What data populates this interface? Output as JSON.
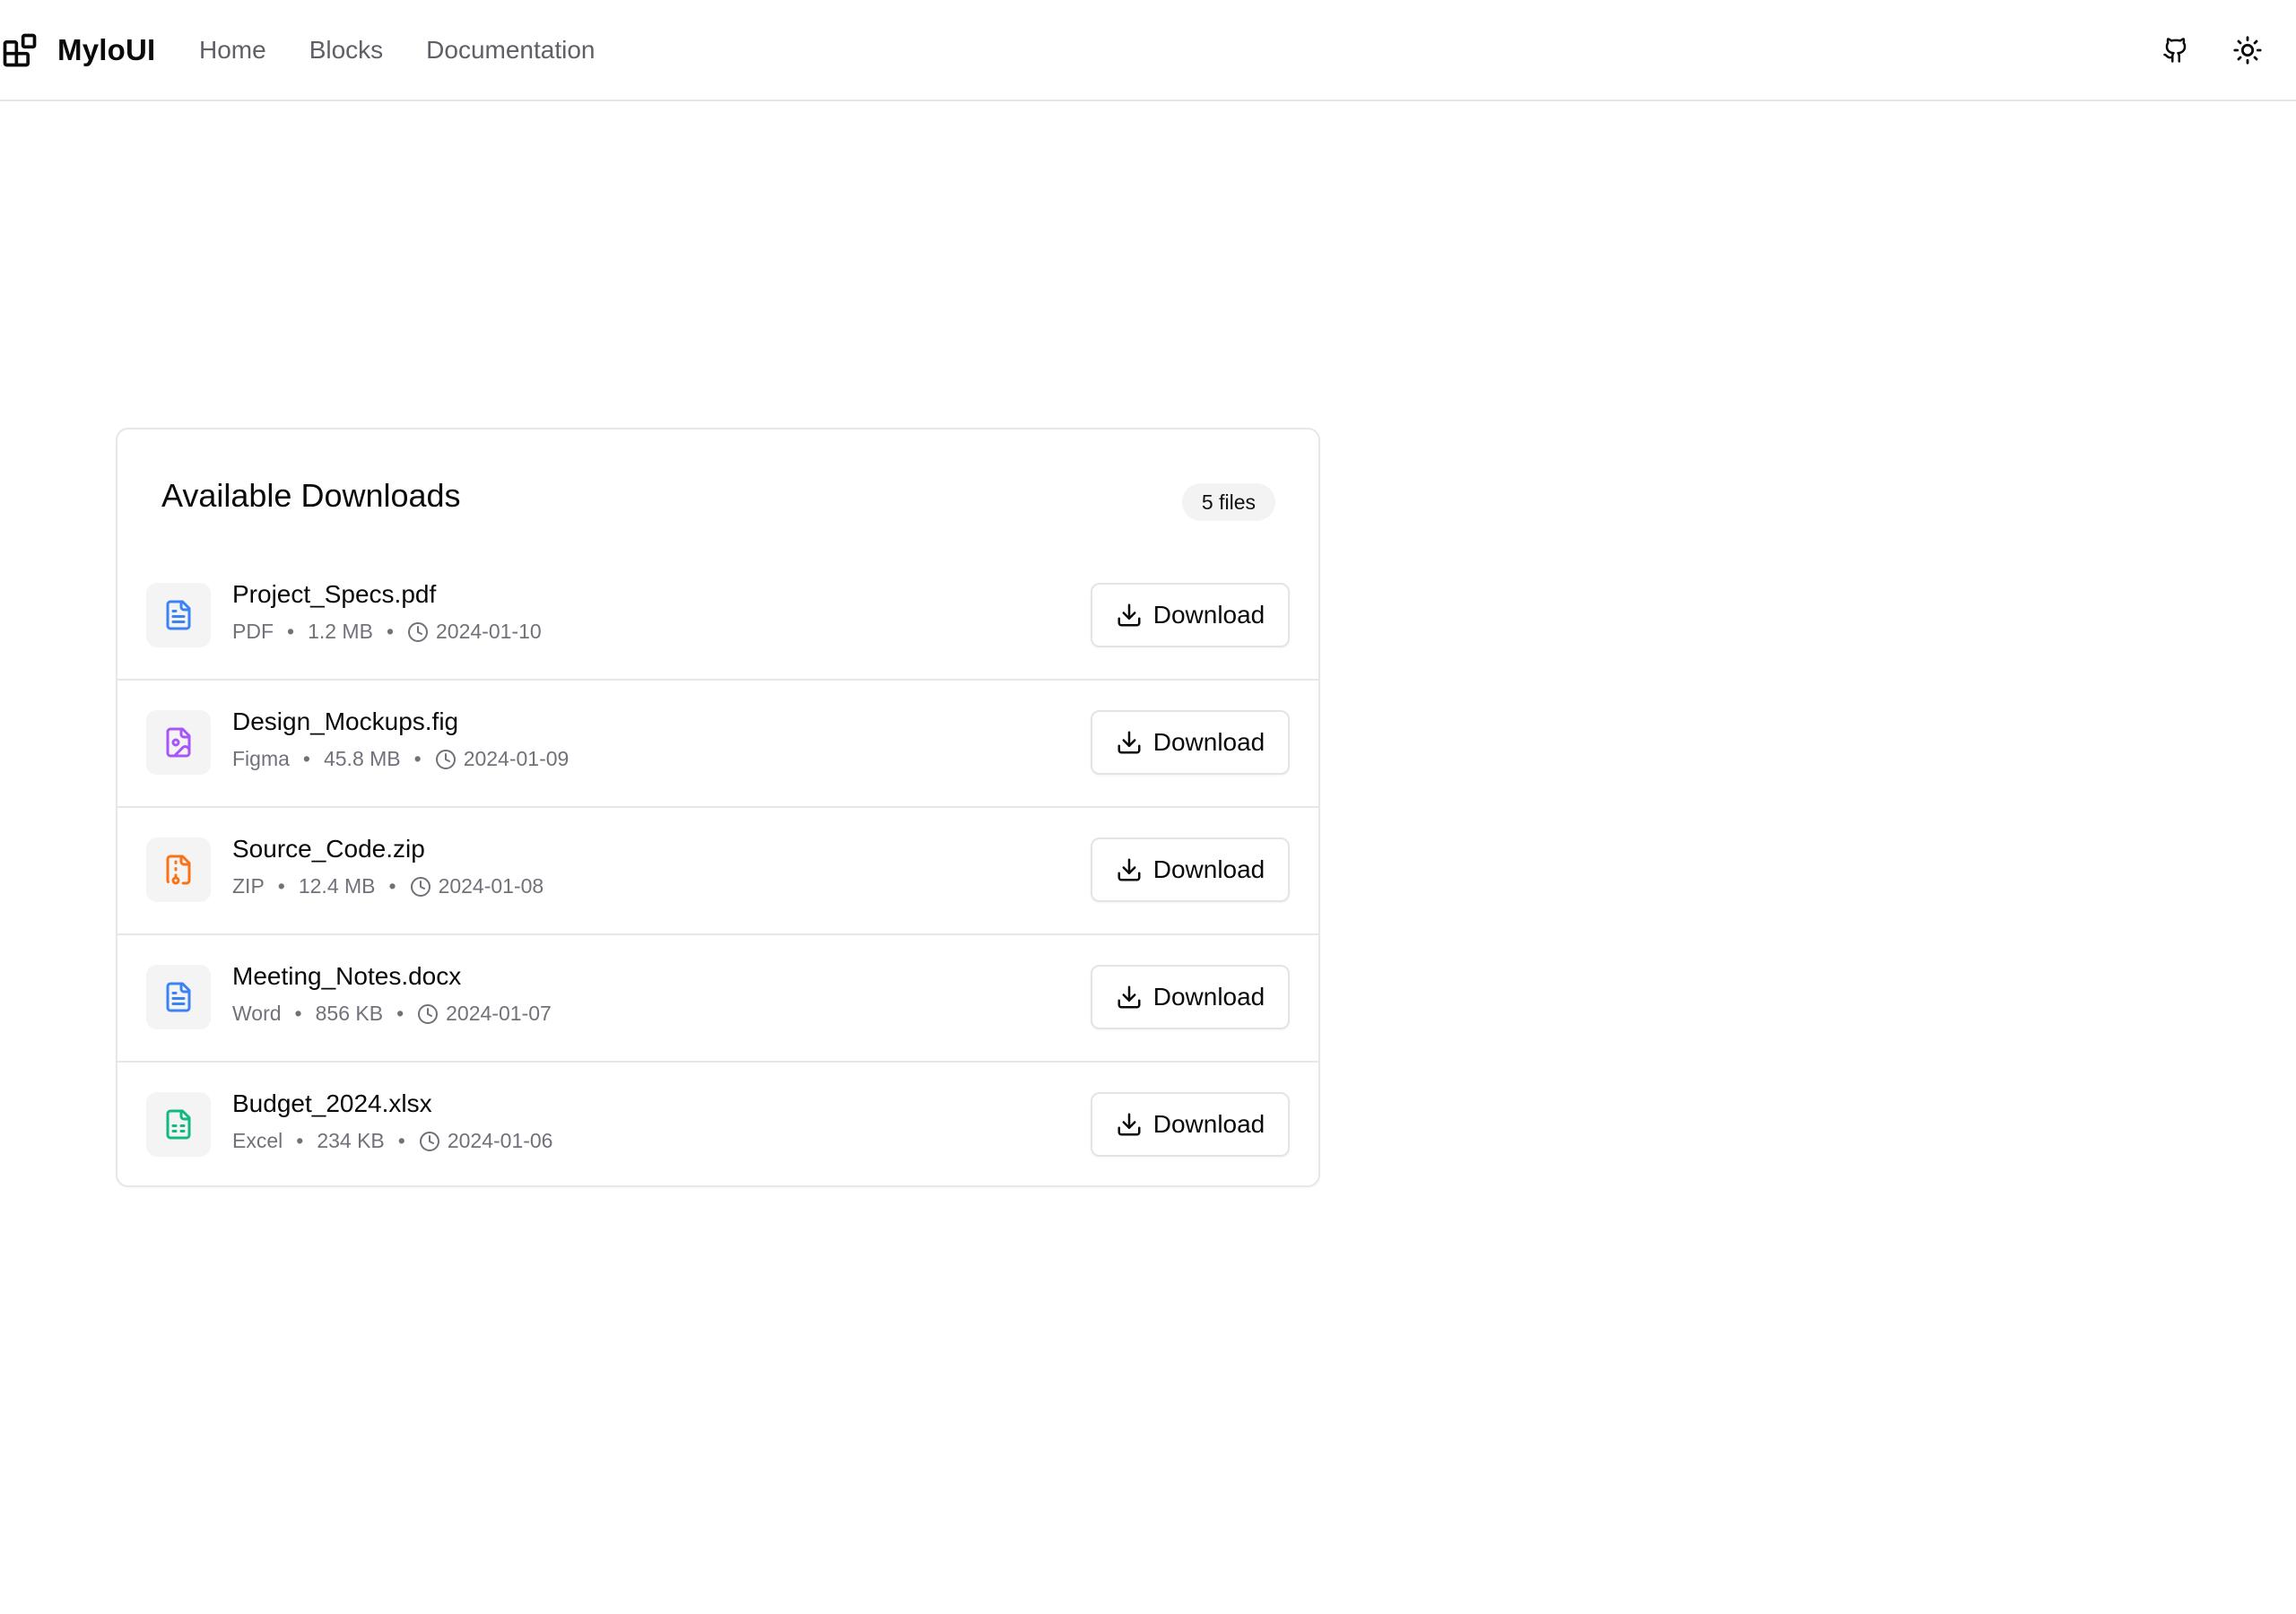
{
  "header": {
    "brand": "MyloUI",
    "nav": [
      "Home",
      "Blocks",
      "Documentation"
    ],
    "icons": [
      "github-icon",
      "sun-icon"
    ]
  },
  "card": {
    "title": "Available Downloads",
    "count": "5 files",
    "download_label": "Download",
    "files": [
      {
        "name": "Project_Specs.pdf",
        "type": "PDF",
        "size": "1.2 MB",
        "date": "2024-01-10",
        "icon": "file-text-icon",
        "color": "#3b82f6"
      },
      {
        "name": "Design_Mockups.fig",
        "type": "Figma",
        "size": "45.8 MB",
        "date": "2024-01-09",
        "icon": "file-image-icon",
        "color": "#a855f7"
      },
      {
        "name": "Source_Code.zip",
        "type": "ZIP",
        "size": "12.4 MB",
        "date": "2024-01-08",
        "icon": "file-archive-icon",
        "color": "#f97316"
      },
      {
        "name": "Meeting_Notes.docx",
        "type": "Word",
        "size": "856 KB",
        "date": "2024-01-07",
        "icon": "file-text-icon",
        "color": "#3b82f6"
      },
      {
        "name": "Budget_2024.xlsx",
        "type": "Excel",
        "size": "234 KB",
        "date": "2024-01-06",
        "icon": "file-spreadsheet-icon",
        "color": "#10b981"
      }
    ]
  }
}
